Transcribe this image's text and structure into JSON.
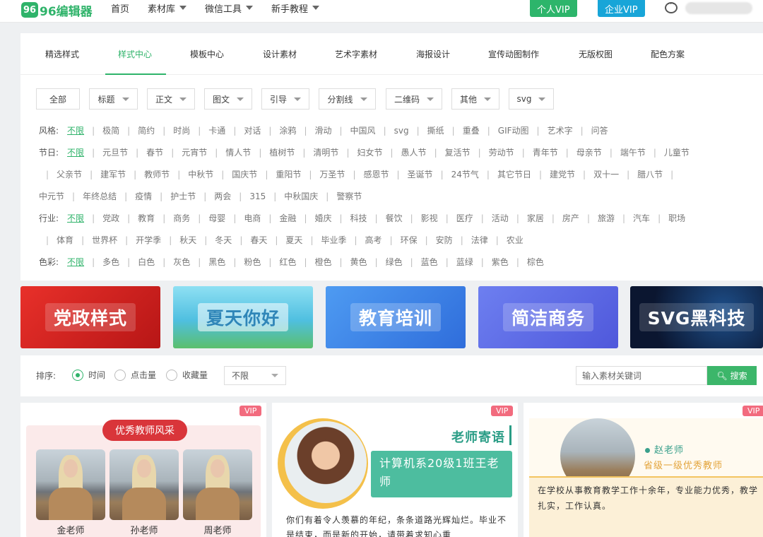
{
  "brand": {
    "logo_text": "96编辑器",
    "logo_glyph": "96"
  },
  "nav": {
    "items": [
      {
        "label": "首页",
        "dropdown": false
      },
      {
        "label": "素材库",
        "dropdown": true
      },
      {
        "label": "微信工具",
        "dropdown": true
      },
      {
        "label": "新手教程",
        "dropdown": true
      }
    ]
  },
  "header": {
    "vip_personal": "个人VIP",
    "vip_enterprise": "企业VIP"
  },
  "tabs": [
    {
      "label": "精选样式"
    },
    {
      "label": "样式中心",
      "active": true
    },
    {
      "label": "模板中心"
    },
    {
      "label": "设计素材"
    },
    {
      "label": "艺术字素材"
    },
    {
      "label": "海报设计"
    },
    {
      "label": "宣传动图制作"
    },
    {
      "label": "无版权图"
    },
    {
      "label": "配色方案"
    }
  ],
  "filters": [
    "全部",
    "标题",
    "正文",
    "图文",
    "引导",
    "分割线",
    "二维码",
    "其他",
    "svg"
  ],
  "style_row": {
    "label": "风格:",
    "items": [
      "不限",
      "极简",
      "简约",
      "时尚",
      "卡通",
      "对话",
      "涂鸦",
      "滑动",
      "中国风",
      "svg",
      "撕纸",
      "重叠",
      "GIF动图",
      "艺术字",
      "问答"
    ]
  },
  "festival_row": {
    "label": "节日:",
    "line1": [
      "不限",
      "元旦节",
      "春节",
      "元宵节",
      "情人节",
      "植树节",
      "清明节",
      "妇女节",
      "愚人节",
      "复活节",
      "劳动节",
      "青年节",
      "母亲节",
      "端午节",
      "儿童节"
    ],
    "line2": [
      "父亲节",
      "建军节",
      "教师节",
      "中秋节",
      "国庆节",
      "重阳节",
      "万圣节",
      "感恩节",
      "圣诞节",
      "24节气",
      "其它节日",
      "建党节",
      "双十一",
      "腊八节"
    ],
    "line3": [
      "中元节",
      "年终总结",
      "疫情",
      "护士节",
      "两会",
      "315",
      "中秋国庆",
      "警察节"
    ]
  },
  "industry_row": {
    "label": "行业:",
    "line1": [
      "不限",
      "党政",
      "教育",
      "商务",
      "母婴",
      "电商",
      "金融",
      "婚庆",
      "科技",
      "餐饮",
      "影视",
      "医疗",
      "活动",
      "家居",
      "房产",
      "旅游",
      "汽车",
      "职场"
    ],
    "line2": [
      "体育",
      "世界杯",
      "开学季",
      "秋天",
      "冬天",
      "春天",
      "夏天",
      "毕业季",
      "高考",
      "环保",
      "安防",
      "法律",
      "农业"
    ]
  },
  "color_row": {
    "label": "色彩:",
    "items": [
      "不限",
      "多色",
      "白色",
      "灰色",
      "黑色",
      "粉色",
      "红色",
      "橙色",
      "黄色",
      "绿色",
      "蓝色",
      "蓝绿",
      "紫色",
      "棕色"
    ]
  },
  "banners": [
    {
      "label": "党政样式",
      "color": "#d9231f"
    },
    {
      "label": "夏天你好",
      "color": "#6ecfe9"
    },
    {
      "label": "教育培训",
      "color": "#3d86e8"
    },
    {
      "label": "简洁商务",
      "color": "#5a6ce8"
    },
    {
      "label": "SVG黑科技",
      "color": "#0e1a36"
    }
  ],
  "sort": {
    "label": "排序:",
    "options": [
      {
        "label": "时间",
        "selected": true
      },
      {
        "label": "点击量",
        "selected": false
      },
      {
        "label": "收藏量",
        "selected": false
      }
    ],
    "select_value": "不限",
    "search_placeholder": "输入素材关键词",
    "search_button": "搜索"
  },
  "cards": [
    {
      "vip": "VIP",
      "badge": "优秀教师风采",
      "teachers": [
        "金老师",
        "孙老师",
        "周老师"
      ]
    },
    {
      "vip": "VIP",
      "title": "老师寄语",
      "subtitle": "计算机系20级1班王老师",
      "text": "你们有着令人羡慕的年纪，条条道路光辉灿烂。毕业不是结束，而是新的开始，请带着求知心重"
    },
    {
      "vip": "VIP",
      "name": "赵老师",
      "title": "省级一级优秀教师",
      "text": "在学校从事教育教学工作十余年，专业能力优秀，教学扎实，工作认真。"
    }
  ]
}
